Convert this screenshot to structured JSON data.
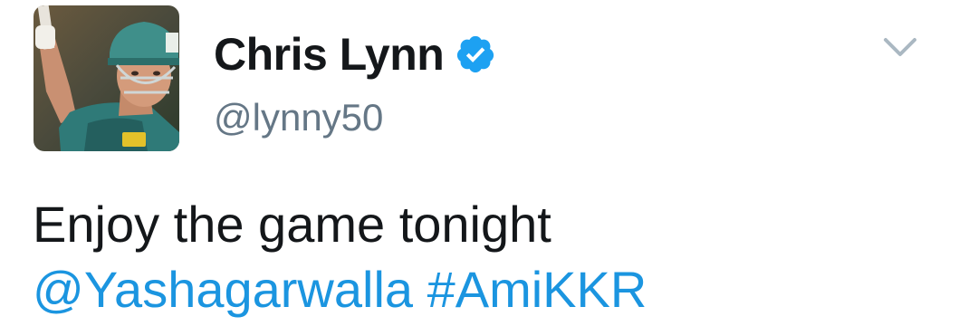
{
  "tweet": {
    "author": {
      "display_name": "Chris Lynn",
      "handle": "@lynny50",
      "verified": true,
      "avatar_icon": "profile-photo"
    },
    "menu_icon": "chevron-down-icon",
    "text_line1": "Enjoy the game tonight",
    "mention": "@Yashagarwalla",
    "hashtag": "#AmiKKR"
  },
  "colors": {
    "name": "#14171a",
    "handle": "#657786",
    "link": "#1b95e0",
    "verified_badge": "#1da1f2",
    "caret": "#aab8c2"
  }
}
